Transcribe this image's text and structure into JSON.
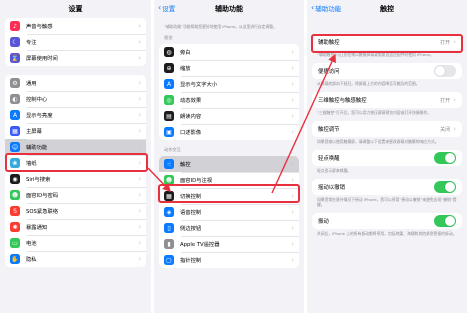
{
  "panel1": {
    "title": "设置",
    "groups": [
      [
        {
          "label": "声音与触感",
          "icon": "speaker-icon",
          "color": "#ff2d55",
          "glyph": "♪"
        },
        {
          "label": "专注",
          "icon": "moon-icon",
          "color": "#5856d6",
          "glyph": "☾"
        },
        {
          "label": "屏幕使用时间",
          "icon": "hourglass-icon",
          "color": "#5856d6",
          "glyph": "⌛"
        }
      ],
      [
        {
          "label": "通用",
          "icon": "gear-icon",
          "color": "#8e8e93",
          "glyph": "⚙"
        },
        {
          "label": "控制中心",
          "icon": "toggles-icon",
          "color": "#8e8e93",
          "glyph": "◐"
        },
        {
          "label": "显示与亮度",
          "icon": "aa-icon",
          "color": "#0a7aff",
          "glyph": "A"
        },
        {
          "label": "主屏幕",
          "icon": "grid-icon",
          "color": "#3a5afc",
          "glyph": "▦"
        },
        {
          "label": "辅助功能",
          "icon": "accessibility-icon",
          "color": "#0a7aff",
          "glyph": "☺"
        },
        {
          "label": "墙纸",
          "icon": "flower-icon",
          "color": "#36aadc",
          "glyph": "❀"
        },
        {
          "label": "Siri与搜索",
          "icon": "siri-icon",
          "color": "#1c1c1e",
          "glyph": "◉"
        },
        {
          "label": "面容ID与密码",
          "icon": "faceid-icon",
          "color": "#34c759",
          "glyph": "☻"
        },
        {
          "label": "SOS紧急联络",
          "icon": "sos-icon",
          "color": "#ff3b30",
          "glyph": "S"
        },
        {
          "label": "暴露通知",
          "icon": "exposure-icon",
          "color": "#ff3b30",
          "glyph": "✺"
        },
        {
          "label": "电池",
          "icon": "battery-icon",
          "color": "#34c759",
          "glyph": "▭"
        },
        {
          "label": "隐私",
          "icon": "hand-icon",
          "color": "#0a7aff",
          "glyph": "✋"
        }
      ]
    ]
  },
  "panel2": {
    "back": "设置",
    "title": "辅助功能",
    "intro": "“辅助功能”功能帮助您更好地使用 iPhone。从这里进行自定调整。",
    "vision_header": "视觉",
    "vision": [
      {
        "label": "旁白",
        "icon": "voiceover-icon",
        "color": "#1c1c1e",
        "glyph": "◍"
      },
      {
        "label": "缩放",
        "icon": "zoom-icon",
        "color": "#1c1c1e",
        "glyph": "⊕"
      },
      {
        "label": "显示与文字大小",
        "icon": "aa-icon",
        "color": "#0a7aff",
        "glyph": "A"
      },
      {
        "label": "动态效果",
        "icon": "motion-icon",
        "color": "#34c759",
        "glyph": "◎"
      },
      {
        "label": "朗读内容",
        "icon": "speech-icon",
        "color": "#1c1c1e",
        "glyph": "▤"
      },
      {
        "label": "口述影像",
        "icon": "ad-icon",
        "color": "#0a7aff",
        "glyph": "▣"
      }
    ],
    "motor_header": "动作交互",
    "motor": [
      {
        "label": "触控",
        "icon": "touch-icon",
        "color": "#0a7aff",
        "glyph": "☝"
      },
      {
        "label": "面容ID与注视",
        "icon": "faceid-icon",
        "color": "#34c759",
        "glyph": "☻"
      },
      {
        "label": "切换控制",
        "icon": "switch-icon",
        "color": "#1c1c1e",
        "glyph": "▦"
      },
      {
        "label": "语音控制",
        "icon": "voice-icon",
        "color": "#0a7aff",
        "glyph": "◈"
      },
      {
        "label": "侧边按钮",
        "icon": "side-button-icon",
        "color": "#0a7aff",
        "glyph": "▯"
      },
      {
        "label": "Apple TV遥控器",
        "icon": "remote-icon",
        "color": "#8e8e93",
        "glyph": "▮"
      },
      {
        "label": "指针控制",
        "icon": "pointer-icon",
        "color": "#0a7aff",
        "glyph": "▢"
      }
    ]
  },
  "panel3": {
    "back": "辅助功能",
    "title": "触控",
    "assistive_label": "辅助触控",
    "assistive_value": "打开",
    "assistive_desc": "“辅助触控”可让您在难以触摸屏幕或需要自适应配件时使用 iPhone。",
    "reach_label": "便捷访问",
    "reach_desc": "从屏幕底部向下轻扫，将屏幕上方的内容降至可触及的范围。",
    "haptic_label": "三维触控与触感触控",
    "haptic_value": "打开",
    "haptic_desc": "“三维触控”打开后，您可以用力按压屏幕预览内容或打开快捷操作。",
    "accom_label": "触控调节",
    "accom_value": "关闭",
    "accom_desc": "如果您难以使用触摸屏，请调整以下设置来更改屏幕对触摸的响应方式。",
    "wake_label": "轻点唤醒",
    "wake_desc": "轻点显示屏来唤醒。",
    "shake_label": "摇动以撤销",
    "shake_desc": "如果您常在意外情况下摇动 iPhone，您可以停用“摇动以撤销”来避免出现“撤销”提醒。",
    "vibration_label": "振动",
    "vibration_desc": "关闭后，iPhone 上的所有振动都将停用，包括地震、海啸和其他紧急警报的振动。"
  }
}
